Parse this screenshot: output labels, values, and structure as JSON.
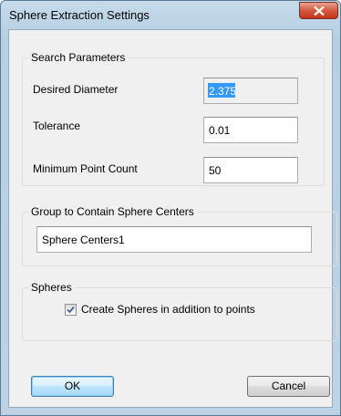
{
  "window": {
    "title": "Sphere Extraction Settings",
    "close_icon": "close-icon"
  },
  "search_parameters": {
    "legend": "Search Parameters",
    "desired_diameter_label": "Desired Diameter",
    "desired_diameter_value": "2.375",
    "tolerance_label": "Tolerance",
    "tolerance_value": "0.01",
    "min_point_count_label": "Minimum Point Count",
    "min_point_count_value": "50"
  },
  "group": {
    "legend": "Group to Contain Sphere Centers",
    "value": "Sphere Centers1"
  },
  "spheres": {
    "legend": "Spheres",
    "create_spheres_label": "Create Spheres in addition to points",
    "create_spheres_checked": true
  },
  "buttons": {
    "ok_label": "OK",
    "cancel_label": "Cancel"
  },
  "colors": {
    "selection": "#3399ff",
    "close_button": "#c2361b",
    "default_button_border": "#3c7fb1"
  }
}
